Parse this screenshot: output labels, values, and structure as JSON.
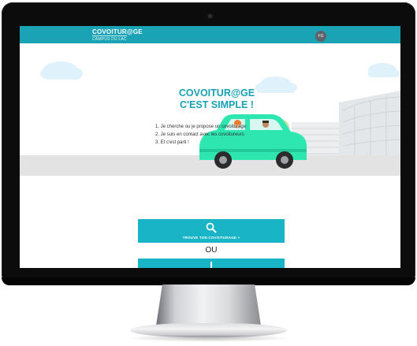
{
  "header": {
    "logo_title": "COVOITUR@GE",
    "logo_subtitle": "CAMPUS DU LAC",
    "user_initials": "FG"
  },
  "hero": {
    "title_line1": "COVOITUR@GE",
    "title_line2": "C'EST SIMPLE !",
    "steps": [
      "1. Je cherche ou je propose un covoiturage",
      "2. Je suis en contact avec les covoitureurs",
      "3. Et c'est parti !"
    ]
  },
  "actions": {
    "search_label": "TROUVE TON COVOITURAGE +",
    "or_text": "OU"
  },
  "colors": {
    "brand": "#1aa3b5",
    "button": "#1ab4c7",
    "title": "#17a2b3",
    "car": "#2ee6b0"
  },
  "icons": {
    "search": "magnifier",
    "second_action": "pin"
  }
}
